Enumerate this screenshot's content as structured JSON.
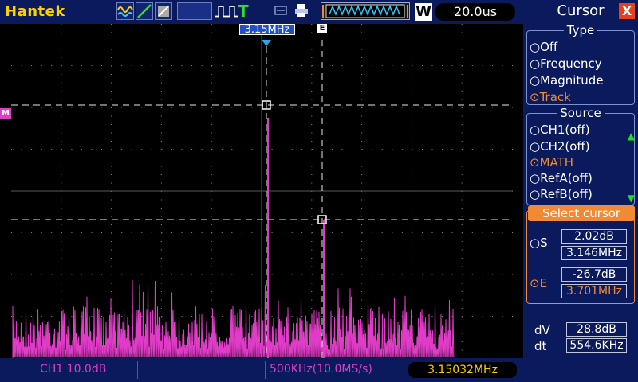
{
  "brand": "Hantek",
  "toolbar": {
    "icons": [
      "wave-icon",
      "trigger-slope-icon",
      "stop-icon",
      "pulse-icon",
      "trigger-t-icon",
      "usb-icon",
      "printer-icon",
      "memory-depth-icon",
      "w-mode-icon"
    ],
    "timebase": "20.0us",
    "w_label": "W",
    "pulse_label": "⎍⎍",
    "t_label": "T"
  },
  "plot": {
    "cursor_s_label": "3.15MHz",
    "cursor_e_marker": "E",
    "math_marker": "M"
  },
  "bottom": {
    "channel": "CH1 10.0dB",
    "span": "500KHz(10.0MS/s)",
    "frequency": "3.15032MHz"
  },
  "panel": {
    "title": "Cursor",
    "close": "X",
    "type_title": "Type",
    "type_options": [
      "Off",
      "Frequency",
      "Magnitude",
      "Track"
    ],
    "type_selected": "Track",
    "source_title": "Source",
    "source_options": [
      "CH1(off)",
      "CH2(off)",
      "MATH",
      "RefA(off)",
      "RefB(off)"
    ],
    "source_selected": "MATH",
    "select_title": "Select cursor",
    "s_label": "S",
    "s_db": "2.02dB",
    "s_freq": "3.146MHz",
    "e_label": "E",
    "e_db": "-26.7dB",
    "e_freq": "3.701MHz",
    "dv_label": "dV",
    "dv_value": "28.8dB",
    "dt_label": "dt",
    "dt_value": "554.6KHz"
  },
  "colors": {
    "trace": "#e03cc8",
    "accent": "#f08a34",
    "panel_bg": "#0a1a5c",
    "brand": "#ffd000"
  }
}
